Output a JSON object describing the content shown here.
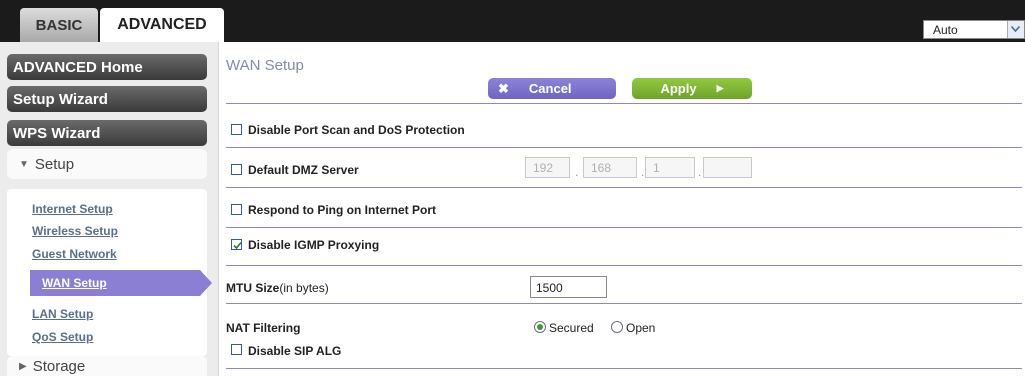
{
  "tabs": {
    "basic": "BASIC",
    "advanced": "ADVANCED"
  },
  "language": {
    "selected": "Auto"
  },
  "sidebar": {
    "advanced_home": "ADVANCED Home",
    "setup_wizard": "Setup Wizard",
    "wps_wizard": "WPS Wizard",
    "setup_section": "Setup",
    "setup_links": [
      "Internet Setup",
      "Wireless Setup",
      "Guest Network",
      "WAN Setup",
      "LAN Setup",
      "QoS Setup"
    ],
    "active_link": "WAN Setup",
    "storage_section": "Storage"
  },
  "main": {
    "title": "WAN Setup",
    "cancel_label": "Cancel",
    "apply_label": "Apply",
    "disable_port_scan": {
      "label": "Disable Port Scan and DoS Protection",
      "checked": false
    },
    "default_dmz": {
      "label": "Default DMZ Server",
      "checked": false,
      "ip": [
        "192",
        "168",
        "1",
        ""
      ]
    },
    "respond_ping": {
      "label": "Respond to Ping on Internet Port",
      "checked": false
    },
    "disable_igmp": {
      "label": "Disable IGMP Proxying",
      "checked": true
    },
    "mtu": {
      "label_bold": "MTU Size",
      "label_unit": "(in bytes)",
      "value": "1500"
    },
    "nat": {
      "label": "NAT Filtering",
      "options": [
        "Secured",
        "Open"
      ],
      "selected": "Secured"
    },
    "disable_sip": {
      "label": "Disable SIP ALG",
      "checked": false
    }
  },
  "colors": {
    "accent_purple": "#8a7fd3",
    "apply_green": "#7fb535",
    "nav_dark": "#4a4a4a",
    "title_blue": "#7f8cab"
  }
}
